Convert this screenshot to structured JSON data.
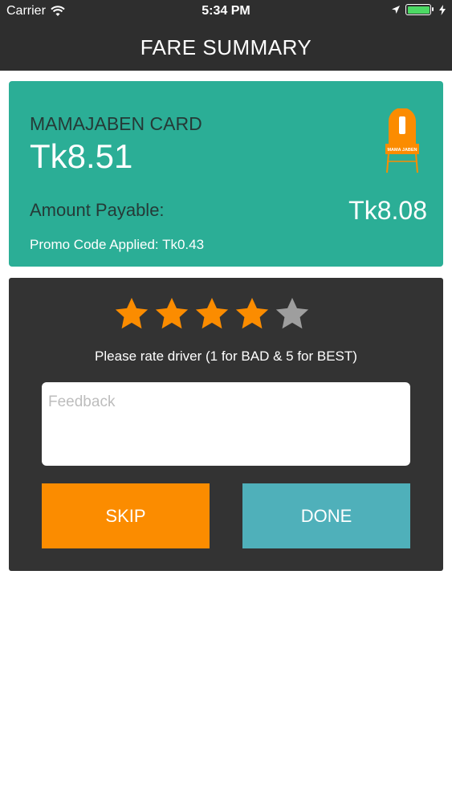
{
  "status_bar": {
    "carrier": "Carrier",
    "time": "5:34 PM",
    "icons": [
      "wifi-icon",
      "location-arrow-icon",
      "battery-icon",
      "charging-bolt-icon"
    ]
  },
  "nav": {
    "title": "FARE SUMMARY"
  },
  "fare_card": {
    "card_name": "MAMAJABEN CARD",
    "card_amount": "Tk8.51",
    "payable_label": "Amount Payable:",
    "payable_amount": "Tk8.08",
    "promo_text": "Promo Code Applied: Tk0.43",
    "logo_text": "MAMA JABEN",
    "background_color": "#2bae96"
  },
  "rating": {
    "selected_stars": 4,
    "max_stars": 5,
    "prompt": "Please rate driver (1 for BAD & 5 for BEST)",
    "feedback_placeholder": "Feedback",
    "feedback_value": "",
    "star_active_color": "#fb8c00",
    "star_inactive_color": "#9e9e9e"
  },
  "buttons": {
    "skip_label": "SKIP",
    "done_label": "DONE",
    "skip_color": "#fb8c00",
    "done_color": "#4fb0ba"
  }
}
